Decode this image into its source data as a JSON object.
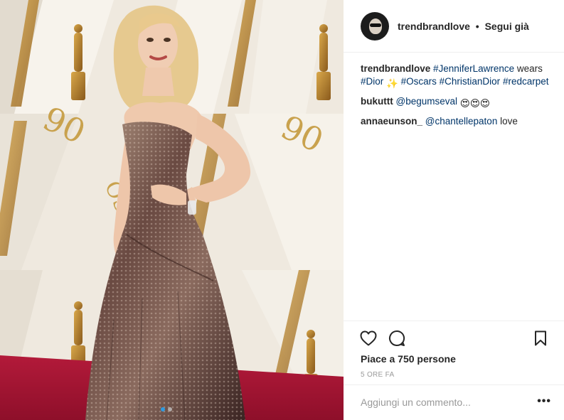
{
  "post": {
    "image_alt": "Woman in a metallic sequined strapless gown on the Oscars red carpet",
    "backdrop_text": "90 OSCARS",
    "carousel": {
      "count": 2,
      "active": 0
    }
  },
  "header": {
    "username": "trendbrandlove",
    "separator": "•",
    "follow_label": "Segui già"
  },
  "caption": {
    "username": "trendbrandlove",
    "parts": [
      {
        "type": "tag",
        "text": "#JenniferLawrence"
      },
      {
        "type": "text",
        "text": " wears "
      },
      {
        "type": "tag",
        "text": "#Dior"
      },
      {
        "type": "text",
        "text": " "
      },
      {
        "type": "emoji",
        "text": "✨"
      },
      {
        "type": "text",
        "text": " "
      },
      {
        "type": "tag",
        "text": "#Oscars"
      },
      {
        "type": "text",
        "text": " "
      },
      {
        "type": "tag",
        "text": "#ChristianDior"
      },
      {
        "type": "text",
        "text": " "
      },
      {
        "type": "tag",
        "text": "#redcarpet"
      }
    ]
  },
  "comments": [
    {
      "username": "bukuttt",
      "mention": "@begumseval",
      "text": "",
      "emojis": "😍😍😍"
    },
    {
      "username": "annaeunson_",
      "mention": "@chantellepaton",
      "text": " love",
      "emojis": ""
    }
  ],
  "actions": {
    "icons": [
      "heart-icon",
      "comment-icon",
      "bookmark-icon"
    ],
    "likes_text": "Piace a 750 persone",
    "timestamp": "5 ORE FA"
  },
  "comment_box": {
    "placeholder": "Aggiungi un commento...",
    "more_label": "•••"
  },
  "colors": {
    "link": "#003569",
    "border": "#efefef",
    "muted": "#999999",
    "carousel_active": "#2f9be0"
  }
}
